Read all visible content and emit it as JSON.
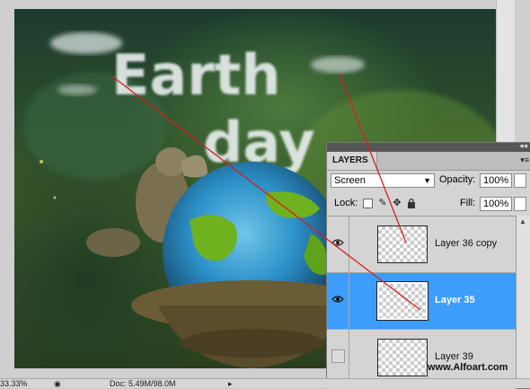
{
  "document": {
    "zoom": "33.33%",
    "doc_info": "Doc: 5.49M/98.0M"
  },
  "layers_panel": {
    "tab_label": "LAYERS",
    "collapse_glyph": "◂◂",
    "menu_glyph": "▾≡",
    "blend_mode": "Screen",
    "opacity_label": "Opacity:",
    "opacity_value": "100%",
    "lock_label": "Lock:",
    "fill_label": "Fill:",
    "fill_value": "100%",
    "layers": [
      {
        "name": "Layer 36 copy",
        "visible": false,
        "selected": false
      },
      {
        "name": "Layer 35",
        "visible": true,
        "selected": true
      },
      {
        "name": "Layer 39",
        "visible": false,
        "selected": false
      }
    ]
  },
  "artwork_text": [
    "Earth",
    "day"
  ],
  "watermark": "www.Alfoart.com",
  "colors": {
    "selection": "#3c9dfb",
    "callout_line": "#d42020",
    "globe_ocean": "#2b8fc6",
    "moss": "#6fb21f"
  },
  "icons": [
    "eye-icon",
    "lock-transparent-icon",
    "brush-icon",
    "move-icon",
    "padlock-icon"
  ]
}
